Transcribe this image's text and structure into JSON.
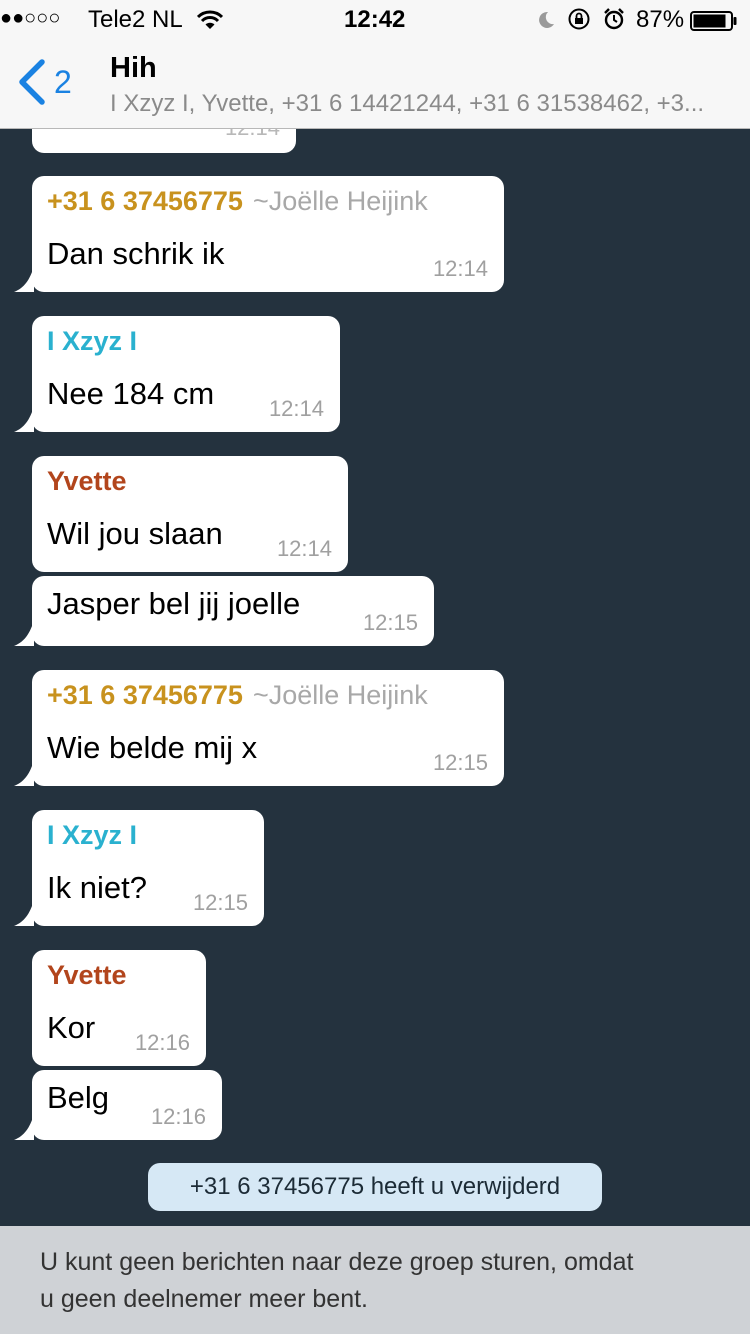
{
  "status_bar": {
    "signal": "●●○○○",
    "carrier": "Tele2 NL",
    "time": "12:42",
    "battery": "87%"
  },
  "header": {
    "back_count": "2",
    "title": "Hih",
    "subtitle": "I Xzyz I, Yvette, +31 6 14421244, +31 6 31538462, +3..."
  },
  "colors": {
    "accent": "#1a82e2",
    "chat_bg": "#24323e",
    "sender_gold": "#c8921e",
    "sender_teal": "#2ab1cf",
    "sender_rust": "#b2451c"
  },
  "messages": [
    {
      "sender": "",
      "pushname": "",
      "text": "",
      "time": "12:14"
    },
    {
      "sender": "+31 6 37456775",
      "pushname": "~Joëlle Heijink",
      "text": "Dan schrik ik",
      "time": "12:14"
    },
    {
      "sender": "I Xzyz I",
      "pushname": "",
      "text": "Nee 184 cm",
      "time": "12:14"
    },
    {
      "sender": "Yvette",
      "pushname": "",
      "text": "Wil jou slaan",
      "time": "12:14"
    },
    {
      "sender": "",
      "pushname": "",
      "text": "Jasper bel jij joelle",
      "time": "12:15"
    },
    {
      "sender": "+31 6 37456775",
      "pushname": "~Joëlle Heijink",
      "text": "Wie belde mij x",
      "time": "12:15"
    },
    {
      "sender": "I Xzyz I",
      "pushname": "",
      "text": "Ik niet?",
      "time": "12:15"
    },
    {
      "sender": "Yvette",
      "pushname": "",
      "text": "Kor",
      "time": "12:16"
    },
    {
      "sender": "",
      "pushname": "",
      "text": "Belg",
      "time": "12:16"
    }
  ],
  "system_message": "+31 6 37456775 heeft u verwijderd",
  "footer": {
    "line1": "U kunt geen berichten naar deze groep sturen, omdat",
    "line2": "u geen deelnemer meer bent."
  }
}
